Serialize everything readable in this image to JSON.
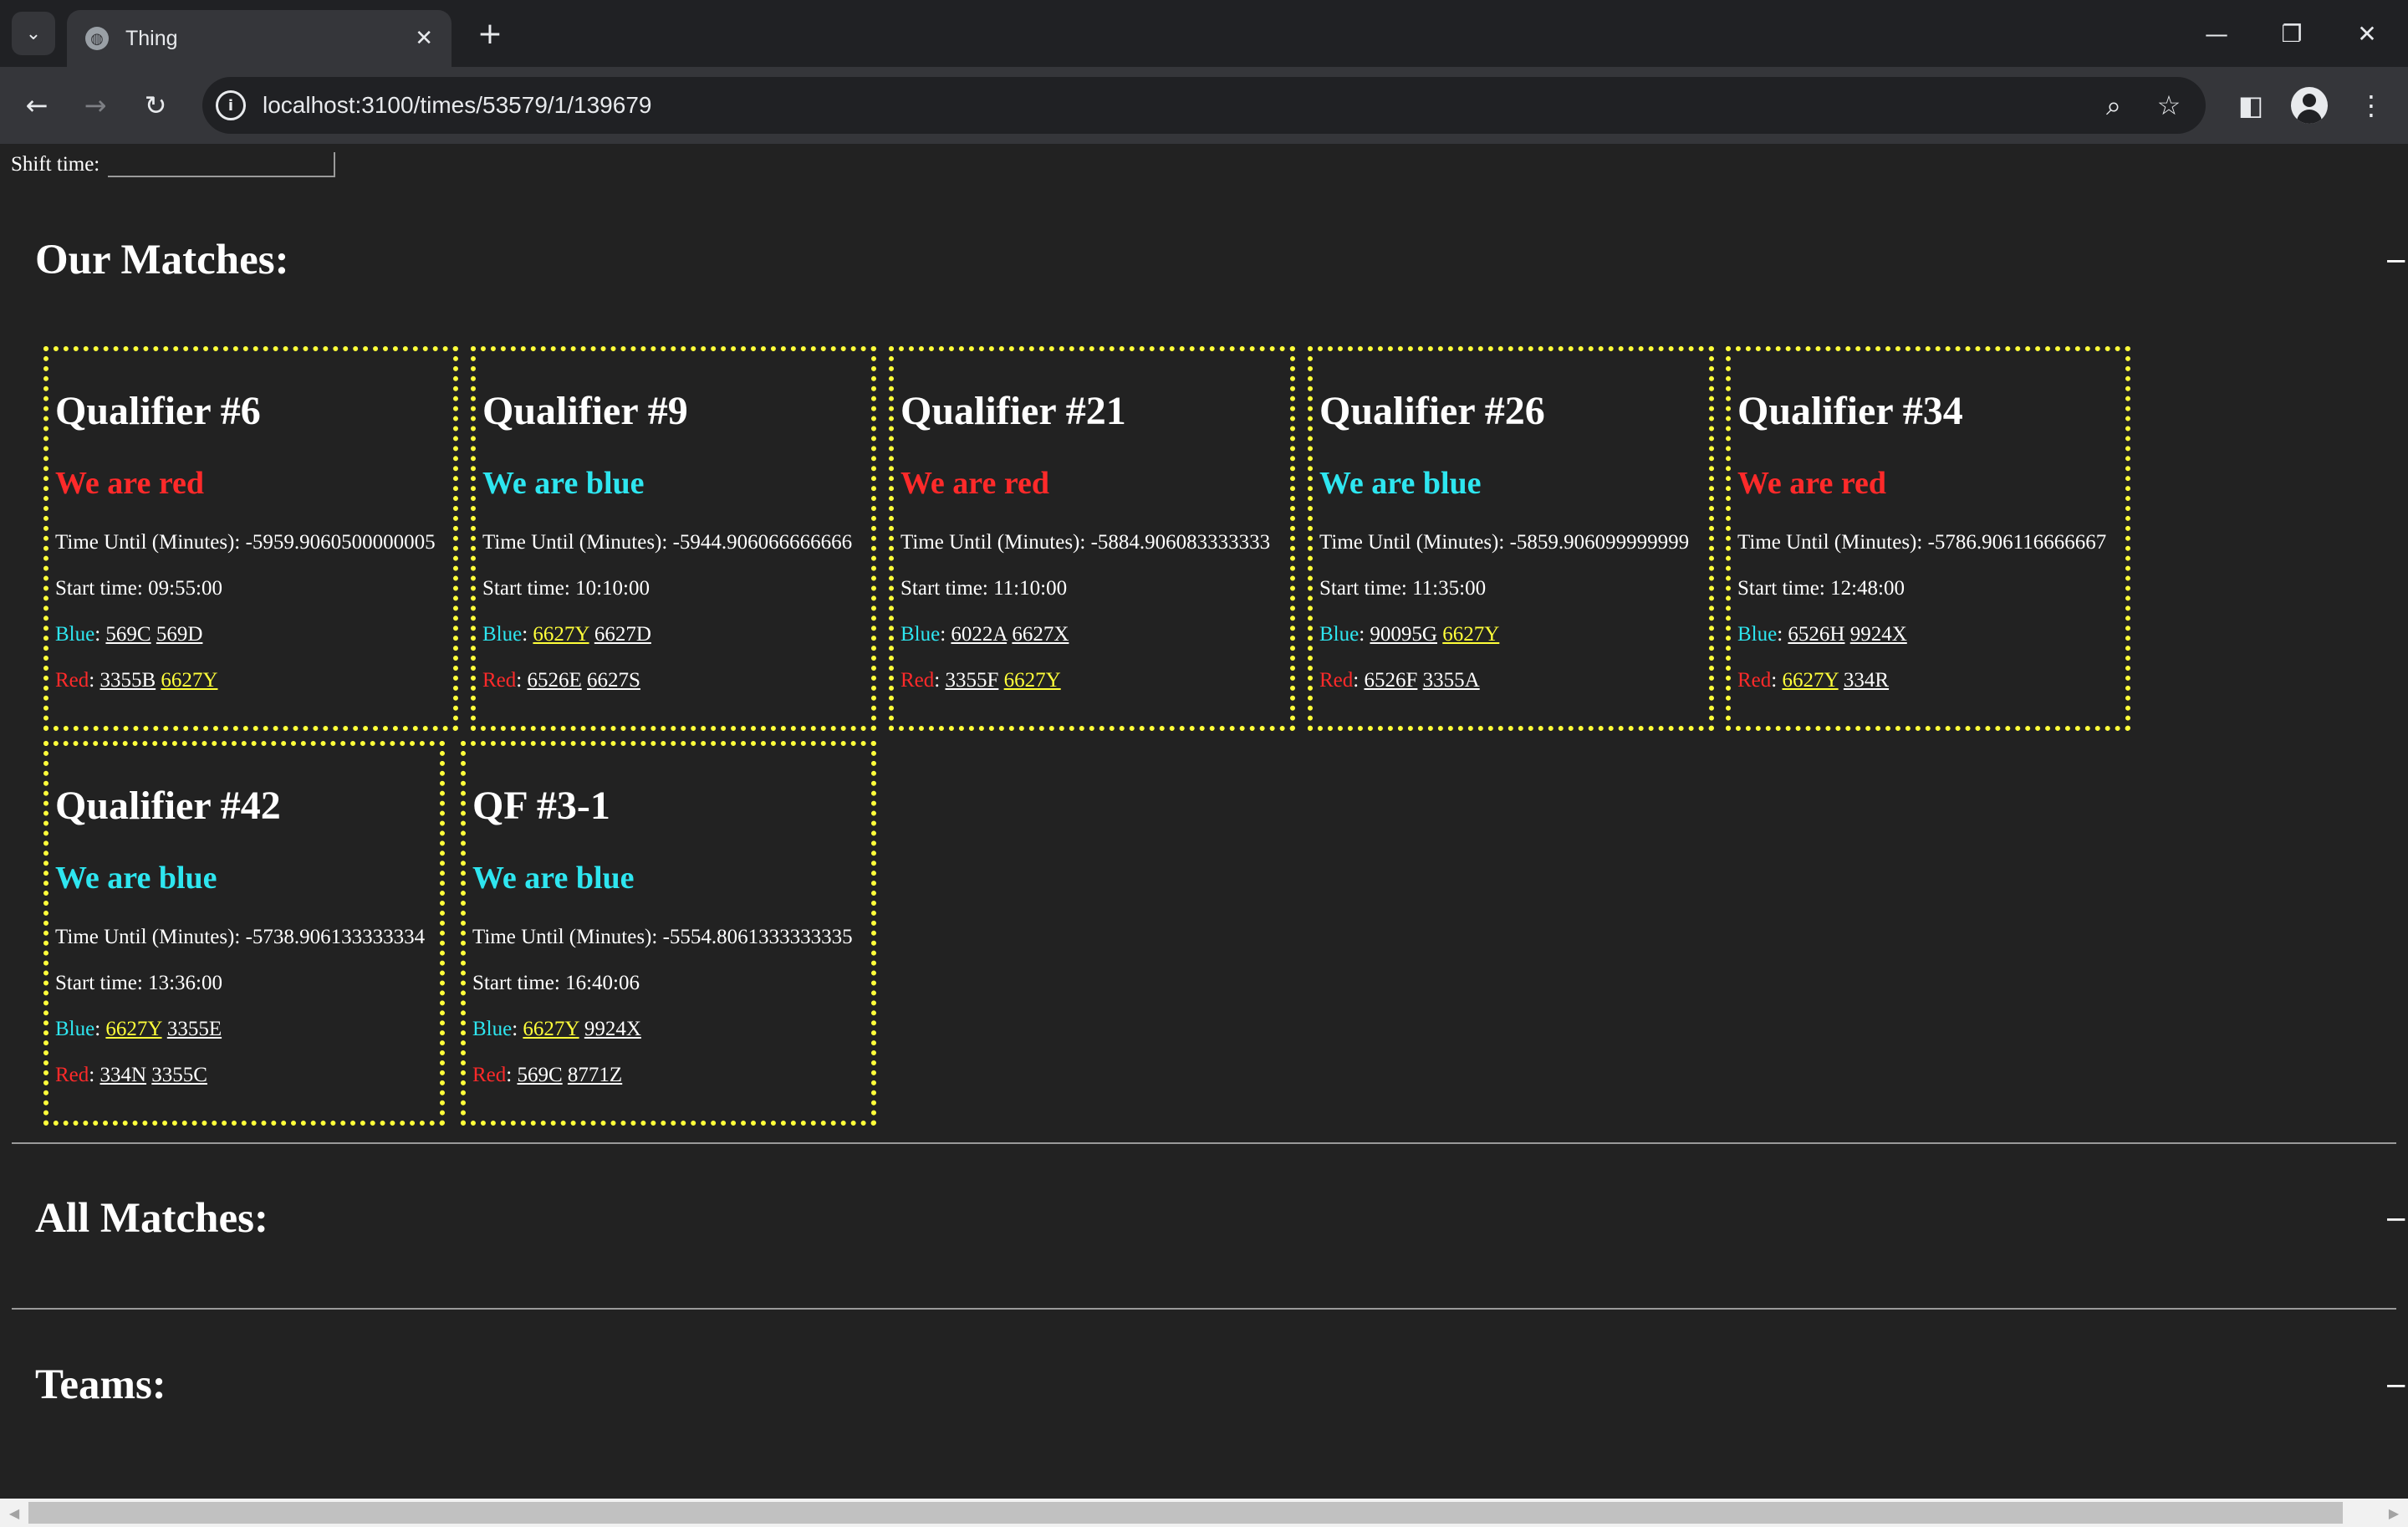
{
  "browser": {
    "tab_list_icon": "chevron-down-icon",
    "tab_title": "Thing",
    "tab_close": "✕",
    "new_tab": "+",
    "url": "localhost:3100/times/53579/1/139679",
    "window_controls": {
      "minimize": "—",
      "restore": "❐",
      "close": "✕"
    }
  },
  "page": {
    "shift_label": "Shift time:",
    "shift_value": "",
    "our_matches_title": "Our Matches:",
    "all_matches_title": "All Matches:",
    "teams_title": "Teams:",
    "collapse_mark": "−",
    "time_until_label": "Time Until (Minutes):",
    "start_time_label": "Start time:",
    "blue_label": "Blue",
    "red_label": "Red",
    "our_team": "6627Y"
  },
  "colors": {
    "red_alliance": "#ff2a2a",
    "blue_alliance": "#2ee6f0",
    "highlight": "#ffff3a",
    "background": "#222222"
  },
  "matches": [
    {
      "name": "Qualifier #6",
      "alliance": "We are red",
      "alliance_color": "red",
      "time_until": "-5959.9060500000005",
      "start_time": "09:55:00",
      "blue": [
        "569C",
        "569D"
      ],
      "red": [
        "3355B",
        "6627Y"
      ]
    },
    {
      "name": "Qualifier #9",
      "alliance": "We are blue",
      "alliance_color": "blue",
      "time_until": "-5944.906066666666",
      "start_time": "10:10:00",
      "blue": [
        "6627Y",
        "6627D"
      ],
      "red": [
        "6526E",
        "6627S"
      ]
    },
    {
      "name": "Qualifier #21",
      "alliance": "We are red",
      "alliance_color": "red",
      "time_until": "-5884.906083333333",
      "start_time": "11:10:00",
      "blue": [
        "6022A",
        "6627X"
      ],
      "red": [
        "3355F",
        "6627Y"
      ]
    },
    {
      "name": "Qualifier #26",
      "alliance": "We are blue",
      "alliance_color": "blue",
      "time_until": "-5859.906099999999",
      "start_time": "11:35:00",
      "blue": [
        "90095G",
        "6627Y"
      ],
      "red": [
        "6526F",
        "3355A"
      ]
    },
    {
      "name": "Qualifier #34",
      "alliance": "We are red",
      "alliance_color": "red",
      "time_until": "-5786.906116666667",
      "start_time": "12:48:00",
      "blue": [
        "6526H",
        "9924X"
      ],
      "red": [
        "6627Y",
        "334R"
      ]
    },
    {
      "name": "Qualifier #42",
      "alliance": "We are blue",
      "alliance_color": "blue",
      "time_until": "-5738.906133333334",
      "start_time": "13:36:00",
      "blue": [
        "6627Y",
        "3355E"
      ],
      "red": [
        "334N",
        "3355C"
      ]
    },
    {
      "name": "QF #3-1",
      "alliance": "We are blue",
      "alliance_color": "blue",
      "time_until": "-5554.8061333333335",
      "start_time": "16:40:06",
      "blue": [
        "6627Y",
        "9924X"
      ],
      "red": [
        "569C",
        "8771Z"
      ]
    }
  ]
}
